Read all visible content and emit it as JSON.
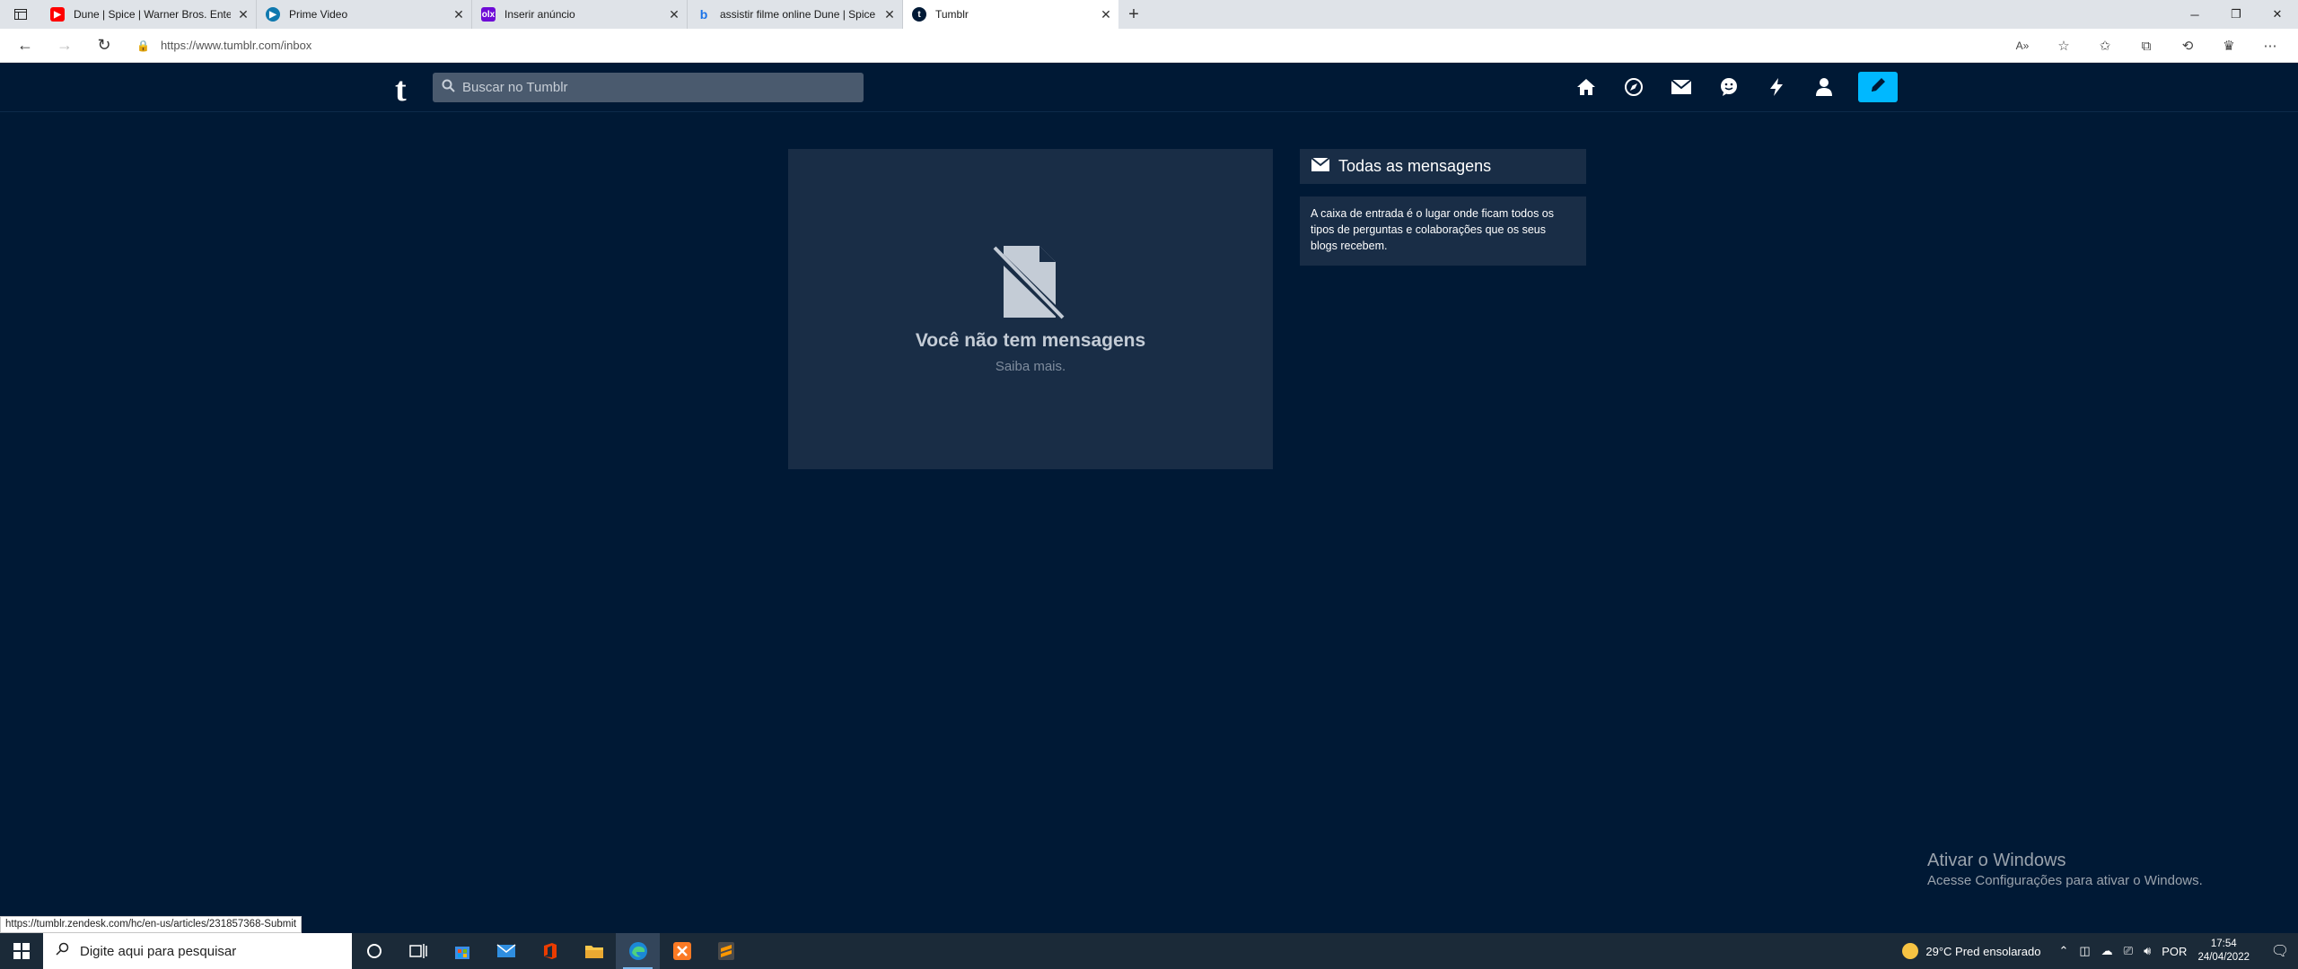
{
  "browser": {
    "tabs": [
      {
        "title": "Dune | Spice | Warner Bros. Ente",
        "favicon_color": "#ff0000",
        "active": false
      },
      {
        "title": "Prime Video",
        "favicon_color": "#0f79af",
        "active": false
      },
      {
        "title": "Inserir anúncio",
        "favicon_color": "#6e0ad6",
        "active": false
      },
      {
        "title": "assistir filme online Dune | Spice",
        "favicon_color": "#1a73e8",
        "active": false
      },
      {
        "title": "Tumblr",
        "favicon_color": "#001935",
        "active": true
      }
    ],
    "url": "https://www.tumblr.com/inbox",
    "status_url": "https://tumblr.zendesk.com/hc/en-us/articles/231857368-Submit"
  },
  "header": {
    "logo": "t",
    "search_placeholder": "Buscar no Tumblr",
    "accent": "#00b8ff"
  },
  "main": {
    "empty_title": "Você não tem mensagens",
    "empty_link": "Saiba mais."
  },
  "sidebar": {
    "title": "Todas as mensagens",
    "description": "A caixa de entrada é o lugar onde ficam todos os tipos de perguntas e colaborações que os seus blogs recebem."
  },
  "watermark": {
    "title": "Ativar o Windows",
    "subtitle": "Acesse Configurações para ativar o Windows."
  },
  "taskbar": {
    "search_placeholder": "Digite aqui para pesquisar",
    "weather": "29°C  Pred ensolarado",
    "language": "POR",
    "time": "17:54",
    "date": "24/04/2022"
  }
}
